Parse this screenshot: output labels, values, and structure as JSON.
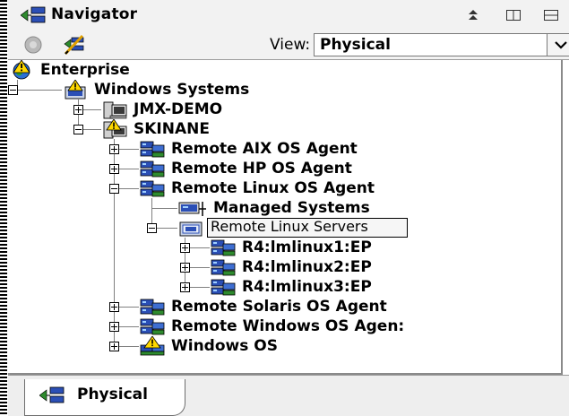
{
  "window": {
    "title": "Navigator",
    "view_label": "View:",
    "view_value": "Physical",
    "bottom_tab": "Physical"
  },
  "tree": [
    {
      "label": "Enterprise",
      "icon": "enterprise-globe-icon",
      "level": 0,
      "expander": "none"
    },
    {
      "label": "Windows Systems",
      "icon": "folder-warning-icon",
      "level": 1,
      "expander": "minus"
    },
    {
      "label": "JMX-DEMO",
      "icon": "computer-icon",
      "level": 2,
      "expander": "plus"
    },
    {
      "label": "SKINANE",
      "icon": "computer-warning-icon",
      "level": 2,
      "expander": "minus"
    },
    {
      "label": "Remote AIX OS Agent",
      "icon": "agent-icon",
      "level": 3,
      "expander": "plus"
    },
    {
      "label": "Remote HP OS Agent",
      "icon": "agent-icon",
      "level": 3,
      "expander": "plus"
    },
    {
      "label": "Remote Linux OS Agent",
      "icon": "agent-icon",
      "level": 3,
      "expander": "minus"
    },
    {
      "label": "Managed Systems",
      "icon": "managed-systems-icon",
      "level": 4,
      "expander": "none"
    },
    {
      "label": "Remote Linux Servers",
      "icon": "folder-icon",
      "level": 4,
      "expander": "minus",
      "selected": true
    },
    {
      "label": "R4:lmlinux1:EP",
      "icon": "agent-icon",
      "level": 5,
      "expander": "plus"
    },
    {
      "label": "R4:lmlinux2:EP",
      "icon": "agent-icon",
      "level": 5,
      "expander": "plus"
    },
    {
      "label": "R4:lmlinux3:EP",
      "icon": "agent-icon",
      "level": 5,
      "expander": "plus"
    },
    {
      "label": "Remote Solaris OS Agent",
      "icon": "agent-icon",
      "level": 3,
      "expander": "plus"
    },
    {
      "label": "Remote Windows OS Agen:",
      "icon": "agent-icon",
      "level": 3,
      "expander": "plus"
    },
    {
      "label": "Windows OS",
      "icon": "agent-warning-icon",
      "level": 3,
      "expander": "plus"
    }
  ],
  "colors": {
    "warning_yellow": "#ffd800",
    "icon_blue": "#2b4fb6",
    "icon_green": "#2e8b2e"
  }
}
